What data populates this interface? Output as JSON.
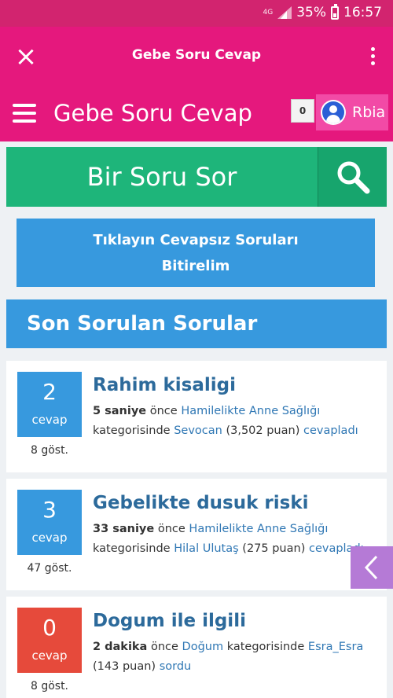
{
  "status_bar": {
    "network": "4G",
    "battery": "35%",
    "time": "16:57"
  },
  "app_toolbar": {
    "close_glyph": "×",
    "title": "Gebe Soru Cevap"
  },
  "site_header": {
    "title": "Gebe Soru Cevap",
    "notification_count": "0",
    "username": "Rbia"
  },
  "ask": {
    "label": "Bir Soru Sor"
  },
  "unanswered_button": {
    "line1": "Tıklayın Cevapsız Soruları",
    "line2": "Bitirelim"
  },
  "section_title": "Son Sorulan Sorular",
  "questions": [
    {
      "answers": "2",
      "answers_label": "cevap",
      "views": "8 göst.",
      "title": "Rahim kisaligi",
      "time": "5 saniye",
      "time_suffix": " önce ",
      "category": "Hamilelikte Anne Sağlığı",
      "category_suffix": " kategorisinde ",
      "user": "Sevocan",
      "points": " (3,502 puan) ",
      "action": "cevapladı",
      "badge_color": "#3799de"
    },
    {
      "answers": "3",
      "answers_label": "cevap",
      "views": "47 göst.",
      "title": "Gebelikte dusuk riski",
      "time": "33 saniye",
      "time_suffix": " önce ",
      "category": "Hamilelikte Anne Sağlığı",
      "category_suffix": " kategorisinde ",
      "user": "Hilal Ulutaş",
      "points": " (275 puan) ",
      "action": "cevapladı",
      "badge_color": "#3799de"
    },
    {
      "answers": "0",
      "answers_label": "cevap",
      "views": "8 göst.",
      "title": "Dogum ile ilgili",
      "time": "2 dakika",
      "time_suffix": " önce ",
      "category": "Doğum",
      "category_suffix": " kategorisinde ",
      "user": "Esra_Esra",
      "points": " (143 puan) ",
      "action": "sordu",
      "badge_color": "#e64a3b"
    }
  ],
  "colors": {
    "status_bar": "#d2246f",
    "header": "#e5187d",
    "ask_bar": "#1eb57a",
    "primary_blue": "#3799de",
    "side_tab": "#b57ad6"
  },
  "icons": {
    "close": "close-icon",
    "menu": "menu-icon",
    "kebab": "more-vert-icon",
    "search": "search-icon",
    "avatar": "user-avatar-icon",
    "side_tab": "chevron-left-icon"
  }
}
